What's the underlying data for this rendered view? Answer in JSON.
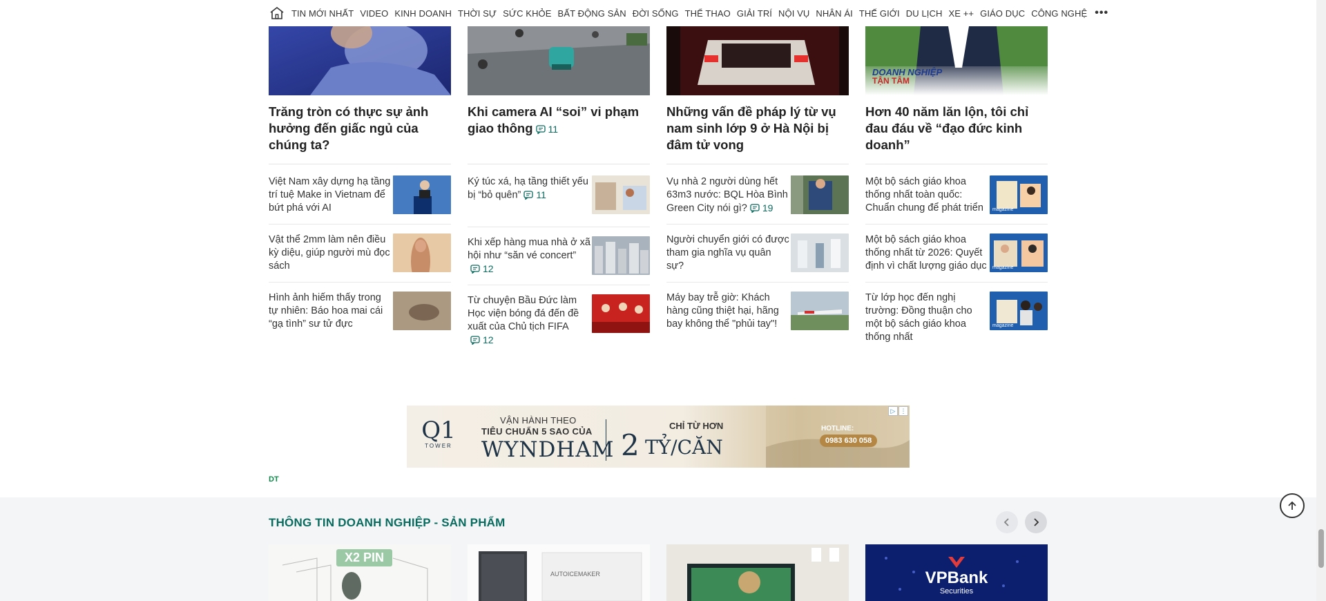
{
  "nav": {
    "items": [
      "TIN MỚI NHẤT",
      "VIDEO",
      "KINH DOANH",
      "THỜI SỰ",
      "SỨC KHỎE",
      "BẤT ĐỘNG SẢN",
      "ĐỜI SỐNG",
      "THỂ THAO",
      "GIẢI TRÍ",
      "NỘI VỤ",
      "NHÂN ÁI",
      "THẾ GIỚI",
      "DU LỊCH",
      "XE ++",
      "GIÁO DỤC",
      "CÔNG NGHỆ"
    ],
    "more": "•••"
  },
  "featured": [
    {
      "title": "Trăng tròn có thực sự ảnh hưởng đến giấc ngủ của chúng ta?",
      "comments": ""
    },
    {
      "title": "Khi camera AI “soi” vi phạm giao thông",
      "comments": "11"
    },
    {
      "title": "Những vấn đề pháp lý từ vụ nam sinh lớp 9 ở Hà Nội bị đâm tử vong",
      "comments": ""
    },
    {
      "title": "Hơn 40 năm lăn lộn, tôi chỉ đau đáu về “đạo đức kinh doanh”",
      "comments": "",
      "logo_line1": "DOANH NGHIỆP",
      "logo_line2": "TẬN TÂM"
    }
  ],
  "columns": [
    [
      {
        "title": "Việt Nam xây dựng hạ tầng trí tuệ Make in Vietnam để bứt phá với AI",
        "comments": ""
      },
      {
        "title": "Vật thể 2mm làm nên điều kỳ diệu, giúp người mù đọc sách",
        "comments": ""
      },
      {
        "title": "Hình ảnh hiếm thấy trong tự nhiên: Báo hoa mai cái “gạ tình” sư tử đực",
        "comments": ""
      }
    ],
    [
      {
        "title": "Ký túc xá, hạ tầng thiết yếu bị “bỏ quên”",
        "comments": "11"
      },
      {
        "title": "Khi xếp hàng mua nhà ở xã hội như “săn vé concert”",
        "comments": "12"
      },
      {
        "title": "Từ chuyện Bầu Đức làm Học viện bóng đá đến đề xuất của Chủ tịch FIFA",
        "comments": "12"
      }
    ],
    [
      {
        "title": "Vụ nhà 2 người dùng hết 63m3 nước: BQL Hòa Bình Green City nói gì?",
        "comments": "19"
      },
      {
        "title": "Người chuyển giới có được tham gia nghĩa vụ quân sự?",
        "comments": ""
      },
      {
        "title": "Máy bay trễ giờ: Khách hàng cũng thiệt hại, hãng bay không thể \"phủi tay\"!",
        "comments": ""
      }
    ],
    [
      {
        "title": "Một bộ sách giáo khoa thống nhất toàn quốc: Chuẩn chung để phát triển",
        "comments": "",
        "badge": "magazine"
      },
      {
        "title": "Một bộ sách giáo khoa thống nhất từ 2026: Quyết định vì chất lượng giáo dục",
        "comments": "",
        "badge": "magazine"
      },
      {
        "title": "Từ lớp học đến nghị trường: Đồng thuận cho một bộ sách giáo khoa thống nhất",
        "comments": "",
        "badge": "magazine"
      }
    ]
  ],
  "ad": {
    "brand": "Q1",
    "brand_sub": "TOWER",
    "line1": "VẬN HÀNH THEO",
    "line2": "TIÊU CHUẨN 5 SAO CỦA",
    "line3": "WYNDHAM",
    "price_prefix": "CHỈ TỪ HƠN",
    "price_num": "2",
    "price_unit": "TỶ/CĂN",
    "hotline_label": "HOTLINE:",
    "hotline": "0983 630 058"
  },
  "dt_logo": "DT",
  "business": {
    "title": "THÔNG TIN DOANH NGHIỆP - SẢN PHẨM",
    "cards": [
      {
        "label": "X2 PIN"
      },
      {
        "label": "AUTOICEMAKER"
      },
      {
        "label": ""
      },
      {
        "label": "VPBank",
        "sub": "Securities"
      }
    ]
  },
  "colors": {
    "accent": "#0a6b5f",
    "text": "#222222",
    "section_bg": "#f3f5f7"
  }
}
